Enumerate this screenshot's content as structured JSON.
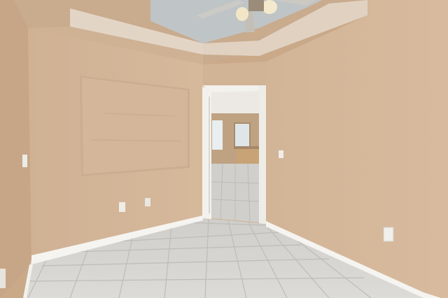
{
  "photo": {
    "subject": "",
    "colors": {
      "wall": "#d3b598",
      "wall_shadow": "#c4a283",
      "ceiling": "#cdb093",
      "tray": "#e2d3c3",
      "tile": "#d9d8d4",
      "grout": "#bdbcb8",
      "trim": "#f5f4f0",
      "doorway_frame": "#f3f1ec",
      "next_room_wall": "#bfa282",
      "cabinet": "#c8a376",
      "window": "#e9eef0"
    }
  }
}
